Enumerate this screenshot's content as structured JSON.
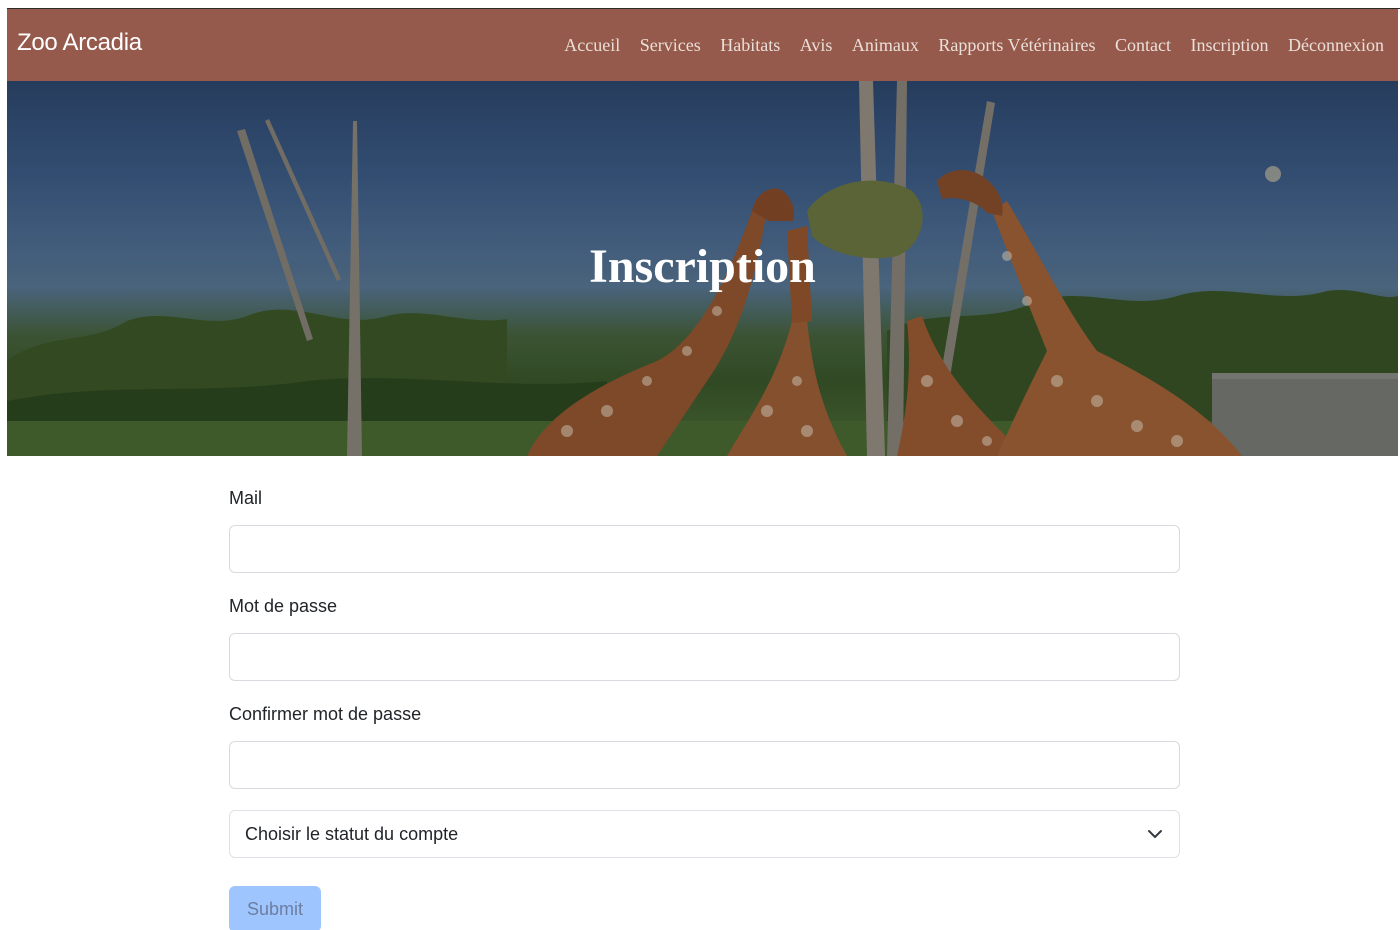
{
  "navbar": {
    "brand": "Zoo Arcadia",
    "links": [
      "Accueil",
      "Services",
      "Habitats",
      "Avis",
      "Animaux",
      "Rapports Vétérinaires",
      "Contact",
      "Inscription",
      "Déconnexion"
    ]
  },
  "hero": {
    "title": "Inscription"
  },
  "form": {
    "mail_label": "Mail",
    "password_label": "Mot de passe",
    "confirm_label": "Confirmer mot de passe",
    "status_select": "Choisir le statut du compte",
    "submit_label": "Submit"
  },
  "colors": {
    "navbar": "#955a4c",
    "submit_button": "#9ec5fe"
  }
}
